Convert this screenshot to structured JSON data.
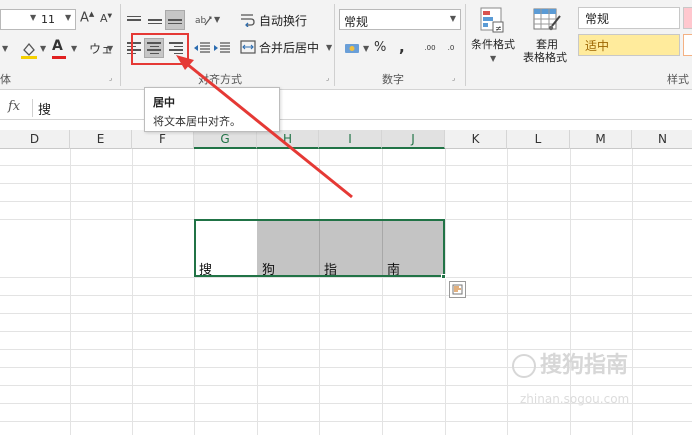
{
  "ribbon": {
    "font_group": {
      "font_size": "11",
      "grow_font_label": "A",
      "shrink_font_label": "A",
      "font_color_label": "A",
      "phonetic_label": "ウェ",
      "group_label_partial": "体"
    },
    "alignment_group": {
      "wrap_text_label": "自动换行",
      "merge_center_label": "合并后居中",
      "group_label": "对齐方式"
    },
    "number_group": {
      "format_value": "常规",
      "percent_label": "%",
      "comma_label": ",",
      "increase_decimal_label": ".00",
      "decrease_decimal_label": ".0",
      "group_label": "数字"
    },
    "styles_group": {
      "conditional_format_label": "条件格式",
      "table_format_label_line1": "套用",
      "table_format_label_line2": "表格格式",
      "normal_style": "常规",
      "neutral_style": "适中",
      "group_label_partial": "样式"
    }
  },
  "tooltip": {
    "title": "居中",
    "description": "将文本居中对齐。"
  },
  "formula_bar": {
    "fx_label": "fx",
    "content": "搜"
  },
  "columns": [
    "D",
    "E",
    "F",
    "G",
    "H",
    "I",
    "J",
    "K",
    "L",
    "M",
    "N"
  ],
  "cells": {
    "g": "搜",
    "h": "狗",
    "i": "指",
    "j": "南"
  },
  "watermark": {
    "text": "搜狗指南",
    "url": "zhinan.sogou.com"
  },
  "colors": {
    "excel_green": "#217346",
    "highlight_red": "#e53935",
    "neutral_yellow": "#ffeb9c",
    "cell_gray": "#c4c4c4"
  }
}
